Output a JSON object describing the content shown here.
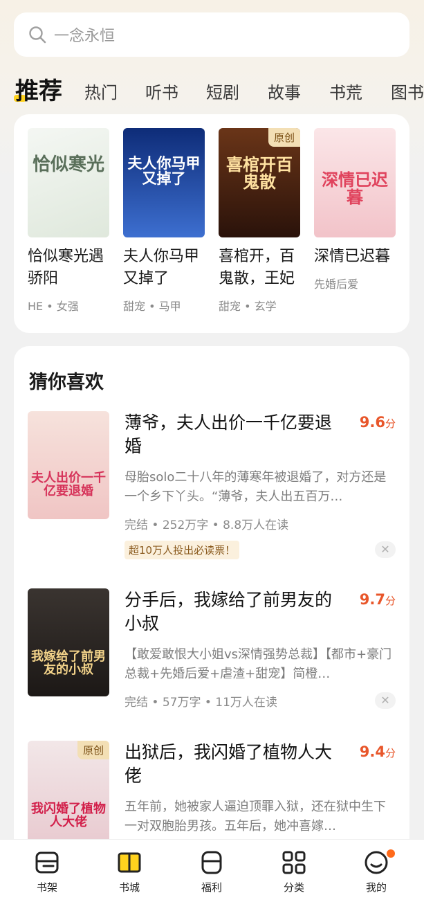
{
  "search": {
    "placeholder": "一念永恒"
  },
  "tabs": [
    {
      "label": "推荐",
      "active": true
    },
    {
      "label": "热门"
    },
    {
      "label": "听书"
    },
    {
      "label": "短剧",
      "dot": true
    },
    {
      "label": "故事"
    },
    {
      "label": "书荒"
    },
    {
      "label": "图书"
    }
  ],
  "featured": [
    {
      "title": "恰似寒光遇骄阳",
      "tags": "HE • 女强",
      "cover_text": "恰似寒光",
      "cover_color": "#e9efe9",
      "text_color": "#5a6f5a"
    },
    {
      "title": "夫人你马甲又掉了",
      "tags": "甜宠 • 马甲",
      "cover_text": "夫人你马甲又掉了",
      "cover_color": "#1d3d8f",
      "text_color": "#ffffff"
    },
    {
      "title": "喜棺开，百鬼散，王妃",
      "tags": "甜宠 • 玄学",
      "cover_text": "喜棺开百鬼散",
      "badge": "原创",
      "cover_color": "#5a2a14",
      "text_color": "#ffe2a1"
    },
    {
      "title": "深情已迟暮",
      "tags": "先婚后爱",
      "cover_text": "深情已迟暮",
      "cover_color": "#f7d9dc",
      "text_color": "#e0435d"
    }
  ],
  "recommend": {
    "title": "猜你喜欢",
    "items": [
      {
        "title": "薄爷，夫人出价一千亿要退婚",
        "score": "9.6",
        "score_unit": "分",
        "desc": "母胎solo二十八年的薄寒年被退婚了，对方还是一个乡下丫头。“薄爷，夫人出五百万…",
        "meta": "完结 • 252万字 • 8.8万人在读",
        "pill": "超10万人投出必读票！",
        "cover_text": "夫人出价一千亿要退婚",
        "cover_color": "#f3d6d0",
        "text_color": "#d6335a"
      },
      {
        "title": "分手后，我嫁给了前男友的小叔",
        "score": "9.7",
        "score_unit": "分",
        "desc": "【敢爱敢恨大小姐vs深情强势总裁】【都市+豪门总裁+先婚后爱+虐渣+甜宠】简橙…",
        "meta": "完结 • 57万字 • 11万人在读",
        "cover_text": "我嫁给了前男友的小叔",
        "cover_color": "#2e2a28",
        "text_color": "#f3d38a"
      },
      {
        "title": "出狱后，我闪婚了植物人大佬",
        "score": "9.4",
        "score_unit": "分",
        "desc": "五年前，她被家人逼迫顶罪入狱，还在狱中生下一对双胞胎男孩。五年后，她冲喜嫁…",
        "badge": "原创",
        "cover_text": "我闪婚了植物人大佬",
        "cover_color": "#efe3e6",
        "text_color": "#d21f4a"
      }
    ]
  },
  "nav": [
    {
      "label": "书架",
      "icon": "bookshelf-icon"
    },
    {
      "label": "书城",
      "icon": "bookstore-icon",
      "active": true
    },
    {
      "label": "福利",
      "icon": "welfare-icon"
    },
    {
      "label": "分类",
      "icon": "category-icon"
    },
    {
      "label": "我的",
      "icon": "profile-icon",
      "dot": true
    }
  ],
  "colors": {
    "accent": "#ffd21e",
    "score": "#e8562a",
    "dot": "#ff6a1a"
  }
}
